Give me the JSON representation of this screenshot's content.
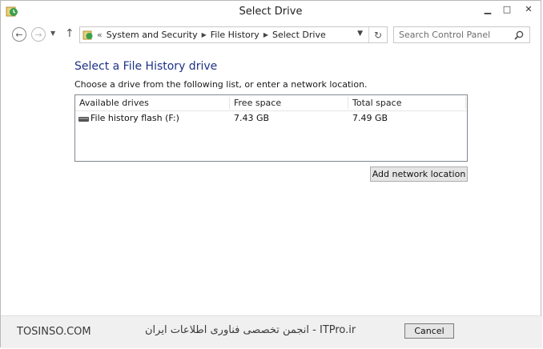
{
  "window": {
    "title": "Select Drive"
  },
  "caption": {
    "minimize": "▁",
    "maximize": "□",
    "close": "✕"
  },
  "nav": {
    "back_icon": "arrow-left-icon",
    "forward_icon": "arrow-right-icon",
    "recent_icon": "chevron-down-icon",
    "up_icon": "arrow-up-icon"
  },
  "address": {
    "prefix": "«",
    "breadcrumbs": [
      "System and Security",
      "File History",
      "Select Drive"
    ]
  },
  "search": {
    "placeholder": "Search Control Panel"
  },
  "main": {
    "heading": "Select a File History drive",
    "subtext": "Choose a drive from the following list, or enter a network location."
  },
  "drive_list": {
    "columns": [
      "Available drives",
      "Free space",
      "Total space"
    ],
    "rows": [
      {
        "name": "File history flash (F:)",
        "free": "7.43 GB",
        "total": "7.49 GB"
      }
    ]
  },
  "buttons": {
    "add_network": "Add network location",
    "cancel": "Cancel"
  },
  "watermark": {
    "left": "TOSINSO.COM",
    "right": "ITPro.ir - انجمن تخصصی فناوری اطلاعات ایران"
  },
  "colors": {
    "heading": "#1e3287",
    "accent_green": "#2e8b3a"
  }
}
